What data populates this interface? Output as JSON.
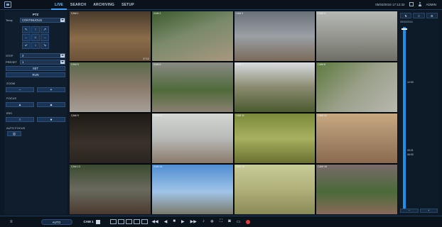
{
  "topbar": {
    "tabs": [
      "LIVE",
      "SEARCH",
      "ARCHIVING",
      "SETUP"
    ],
    "active_tab": "LIVE",
    "datetime": "05/03/2016 17:12:32",
    "user": "ADMIN"
  },
  "ptz": {
    "title": "PTZ",
    "temp_label": "Temp",
    "temp_value": "CONTINUOUS",
    "dpad": [
      "↖",
      "↑",
      "↗",
      "←",
      "⌂",
      "→",
      "↙",
      "↓",
      "↘"
    ],
    "step_label": "STEP",
    "step_value": "3",
    "preset_label": "PRESET",
    "preset_value": "1",
    "set_label": "SET",
    "run_label": "RUN",
    "zoom_label": "ZOOM",
    "focus_label": "FOCUS",
    "iris_label": "IRIS",
    "autofocus_label": "AUTO FOCUS"
  },
  "cameras": [
    {
      "label": "CAM 1",
      "time": "17:12"
    },
    {
      "label": "CAM 2",
      "time": ""
    },
    {
      "label": "CAM 3",
      "time": ""
    },
    {
      "label": "CAM 4",
      "time": ""
    },
    {
      "label": "CAM 5",
      "time": ""
    },
    {
      "label": "CAM 6",
      "time": ""
    },
    {
      "label": "CAM 7",
      "time": ""
    },
    {
      "label": "CAM 8",
      "time": ""
    },
    {
      "label": "CAM 9",
      "time": ""
    },
    {
      "label": "CAM 10",
      "time": ""
    },
    {
      "label": "CAM 11",
      "time": ""
    },
    {
      "label": "CAM 12",
      "time": ""
    },
    {
      "label": "CAM 13",
      "time": ""
    },
    {
      "label": "CAM 14",
      "time": ""
    },
    {
      "label": "CAM 15",
      "time": ""
    },
    {
      "label": "CAM 16",
      "time": ""
    }
  ],
  "timeline": {
    "date": "05/03/2016",
    "mark_1": "12:00",
    "mark_2": "00:21",
    "mark_3": "06:00"
  },
  "bottombar": {
    "menu_icon": "menu-icon",
    "auto_label": "AUTO",
    "cam_label": "CAM 1",
    "icons": [
      "◀◀",
      "◀",
      "■",
      "▶",
      "▶▶"
    ]
  },
  "colors": {
    "accent": "#1e8fe8",
    "record": "#e53b3b"
  }
}
